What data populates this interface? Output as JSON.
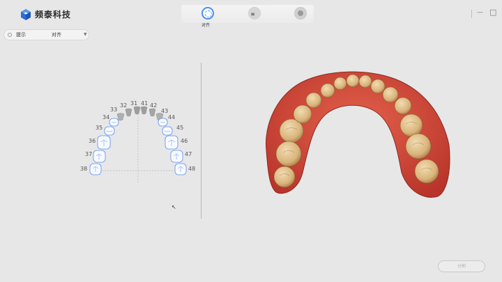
{
  "app": {
    "brand": "频泰科技",
    "logo_icon": "cube-logo-icon",
    "accent_color": "#4b8ff0"
  },
  "steps": {
    "items": [
      {
        "icon": "align-icon",
        "label": "对齐",
        "active": true
      },
      {
        "icon": "teeth-icon",
        "active": false
      },
      {
        "icon": "dot-icon",
        "active": false
      }
    ]
  },
  "window": {
    "minimize_icon": "minimize-icon",
    "close_icon": "close-icon"
  },
  "hint": {
    "label": "提示",
    "value": "对齐"
  },
  "tooth_chart": {
    "numbers": [
      "31",
      "32",
      "33",
      "34",
      "35",
      "36",
      "37",
      "38",
      "41",
      "42",
      "43",
      "44",
      "45",
      "46",
      "47",
      "48"
    ]
  },
  "footer": {
    "next_label": "分割"
  }
}
